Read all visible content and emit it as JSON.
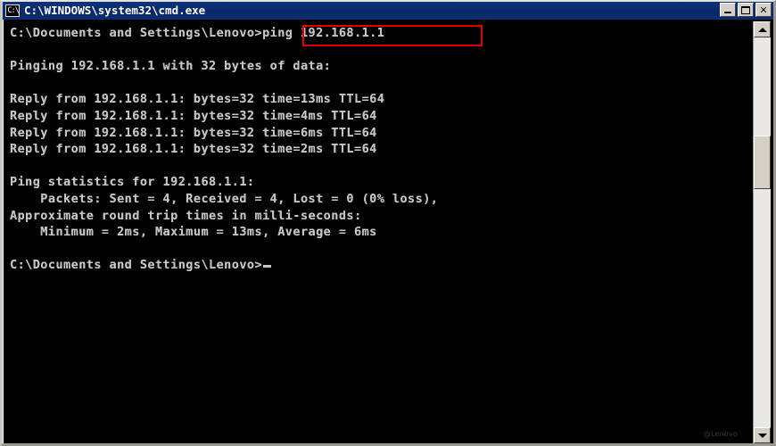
{
  "window": {
    "title": "C:\\WINDOWS\\system32\\cmd.exe",
    "icon_name": "cmd-icon",
    "icon_text": "C:\\",
    "colors": {
      "titlebar": "#0a2a68",
      "console_bg": "#000000",
      "console_text": "#c5c5c5",
      "highlight_box": "#e00000",
      "chrome": "#d4d0c8"
    },
    "buttons": {
      "minimize": "Minimize",
      "maximize": "Maximize",
      "close": "Close"
    }
  },
  "scrollbar": {
    "up_label": "Scroll up",
    "down_label": "Scroll down",
    "thumb_label": "Scroll thumb"
  },
  "console": {
    "lines": [
      "C:\\Documents and Settings\\Lenovo>ping 192.168.1.1",
      "",
      "Pinging 192.168.1.1 with 32 bytes of data:",
      "",
      "Reply from 192.168.1.1: bytes=32 time=13ms TTL=64",
      "Reply from 192.168.1.1: bytes=32 time=4ms TTL=64",
      "Reply from 192.168.1.1: bytes=32 time=6ms TTL=64",
      "Reply from 192.168.1.1: bytes=32 time=2ms TTL=64",
      "",
      "Ping statistics for 192.168.1.1:",
      "    Packets: Sent = 4, Received = 4, Lost = 0 (0% loss),",
      "Approximate round trip times in milli-seconds:",
      "    Minimum = 2ms, Maximum = 13ms, Average = 6ms",
      "",
      "C:\\Documents and Settings\\Lenovo>"
    ],
    "command_entered": ">ping 192.168.1.1",
    "target_host": "192.168.1.1",
    "packet_size_bytes": "32",
    "reply_times_ms": [
      "13",
      "4",
      "6",
      "2"
    ],
    "ttl": "64",
    "packets_sent": "4",
    "packets_received": "4",
    "packets_lost": "0",
    "loss_percent": "0%",
    "minimum_ms": "2ms",
    "maximum_ms": "13ms",
    "average_ms": "6ms",
    "prompt": "C:\\Documents and Settings\\Lenovo>",
    "watermark": "@Lenovo"
  }
}
